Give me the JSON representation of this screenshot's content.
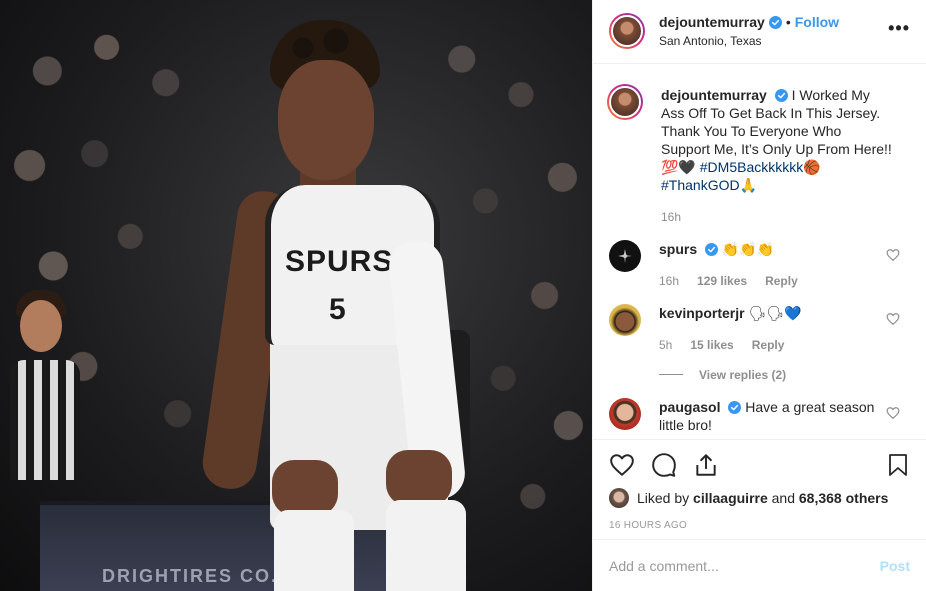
{
  "header": {
    "username": "dejountemurray",
    "follow_separator": "•",
    "follow_label": "Follow",
    "location": "San Antonio, Texas",
    "more_label": "•••"
  },
  "photo": {
    "court_banner_text": "DRIGHTIRES CO..."
  },
  "caption": {
    "username": "dejountemurray",
    "text": "I Worked My Ass Off To Get Back In This Jersey. Thank You To Everyone Who Support Me, It’s Only Up From Here!! 💯🖤",
    "hashtag_1": "#DM5Backkkkkk🏀",
    "hashtag_2": "#ThankGOD🙏",
    "time": "16h"
  },
  "comments": [
    {
      "username": "spurs",
      "text": "👏👏👏",
      "time": "16h",
      "likes": "129 likes",
      "reply_label": "Reply"
    },
    {
      "username": "kevinporterjr",
      "text": "🗣🗣💙",
      "time": "5h",
      "likes": "15 likes",
      "reply_label": "Reply",
      "view_replies": "View replies (2)"
    },
    {
      "username": "paugasol",
      "text": "Have a great season little bro!"
    }
  ],
  "actions": {
    "liked_by_prefix": "Liked by",
    "liked_by_user": "cillaaguirre",
    "liked_by_and": "and",
    "liked_by_others": "68,368 others",
    "time_ago": "16 HOURS AGO"
  },
  "add_comment": {
    "placeholder": "Add a comment...",
    "post_label": "Post"
  },
  "colors": {
    "link_blue": "#3897f0",
    "post_disabled": "#b2dffc",
    "muted": "#8e8e8e",
    "hashtag": "#003569"
  }
}
